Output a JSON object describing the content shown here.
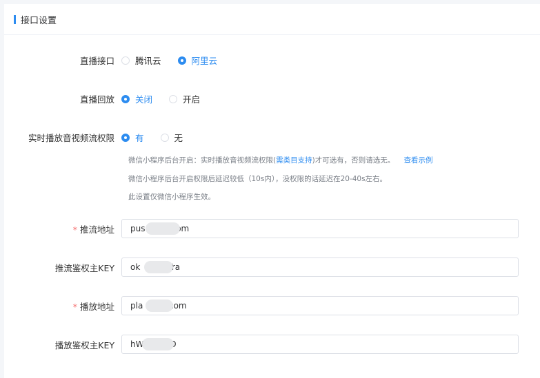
{
  "header": {
    "title": "接口设置"
  },
  "live_api": {
    "label": "直播接口",
    "options": [
      "腾讯云",
      "阿里云"
    ],
    "selected": 1
  },
  "live_playback": {
    "label": "直播回放",
    "options": [
      "关闭",
      "开启"
    ],
    "selected": 0
  },
  "realtime_permission": {
    "label": "实时播放音视频流权限",
    "options": [
      "有",
      "无"
    ],
    "selected": 0,
    "hint1_pre": "微信小程序后台开启：实时播放音视频流权限(",
    "hint1_link": "需类目支持",
    "hint1_post": ")才可选有，否则请选无。",
    "hint1_example": "查看示例",
    "hint2": "微信小程序后台开启权限后延迟较低（10s内），没权限的话延迟在20-40s左右。",
    "hint3": "此设置仅微信小程序生效。"
  },
  "push_url": {
    "label": "推流地址",
    "required": "*",
    "value": "pus          com"
  },
  "push_key": {
    "label": "推流鉴权主KEY",
    "value": "ok        QTra"
  },
  "play_url": {
    "label": "播放地址",
    "required": "*",
    "value": "pla        l.com"
  },
  "play_key": {
    "label": "播放鉴权主KEY",
    "value": "hW         JD"
  }
}
